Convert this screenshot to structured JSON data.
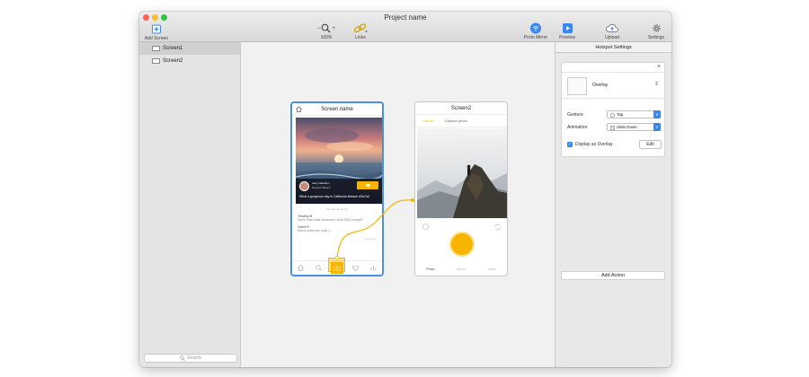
{
  "window": {
    "title": "Project name"
  },
  "toolbar": {
    "add_screen": "Add Screen",
    "zoom_minus": "–",
    "zoom_plus": "+",
    "zoom_level": "100%",
    "links": "Links",
    "proto_mirror": "Proto Mirror",
    "preview": "Preview",
    "upload": "Upload",
    "settings": "Settings"
  },
  "sidebar": {
    "screens": [
      "Screen1",
      "Screen2"
    ],
    "search_placeholder": "Search"
  },
  "screen1": {
    "title": "Screen name",
    "user_name": "Larry Hamilton",
    "location": "Newport Beach",
    "caption": "What a gorgeous day in California #beach #SoCal",
    "comment_count": "22 Comments (3)",
    "comments": [
      {
        "user": "Timothy M.",
        "text": "Damn that looks awesome Larry! BBQ tonight?"
      },
      {
        "user": "Calvin P.",
        "text": "Whoa sweet pic dude :)"
      }
    ],
    "view_more": "view more"
  },
  "screen2": {
    "title": "Screen2",
    "tab_cancel": "Cancel",
    "tab_capture": "Capture photo",
    "bottom_tabs": [
      "Photo",
      "Album",
      "Video"
    ]
  },
  "hotspot_settings": {
    "header": "Hotspot Settings",
    "transition_name": "Overlay",
    "gesture_label": "Gesture",
    "gesture_value": "Tap",
    "animation_label": "Animation",
    "animation_value": "Slide Down",
    "display_overlay_label": "Display as Overlay",
    "display_overlay_checked": true,
    "edit_button": "Edit",
    "add_action": "Add Action"
  },
  "colors": {
    "accent_yellow": "#f7b500",
    "selection_blue": "#4a90e2",
    "control_blue": "#3a86f0"
  }
}
